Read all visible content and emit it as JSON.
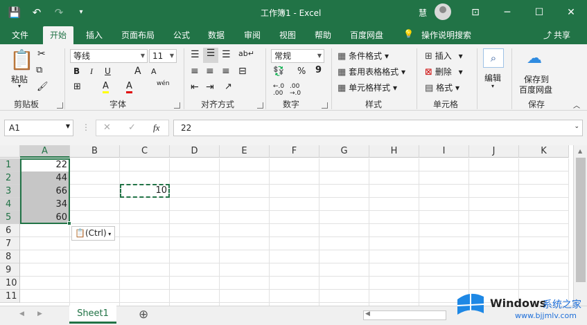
{
  "titlebar": {
    "title": "工作簿1  -  Excel",
    "user": "慧",
    "qat": {
      "save_icon": "💾",
      "undo_icon": "↶",
      "redo_icon": "↷",
      "customize_icon": "▾"
    },
    "window": {
      "ribbon_options": "⊡",
      "minimize": "─",
      "maximize": "☐",
      "close": "✕"
    }
  },
  "tabs": [
    "文件",
    "开始",
    "插入",
    "页面布局",
    "公式",
    "数据",
    "审阅",
    "视图",
    "帮助",
    "百度网盘"
  ],
  "tell_me": "操作说明搜索",
  "share": "共享",
  "ribbon": {
    "clipboard": {
      "label": "剪贴板",
      "paste": "粘贴"
    },
    "font": {
      "label": "字体",
      "name": "等线",
      "size": "11",
      "bold": "B",
      "italic": "I",
      "underline": "U",
      "grow": "A",
      "shrink": "A",
      "fill_icon": "A",
      "color_icon": "A",
      "wen": "wén"
    },
    "alignment": {
      "label": "对齐方式"
    },
    "number": {
      "label": "数字",
      "format": "常规",
      "percent": "%",
      "comma": "9"
    },
    "styles": {
      "label": "样式",
      "conditional": "条件格式",
      "as_table": "套用表格格式",
      "cell_styles": "单元格样式"
    },
    "cells": {
      "label": "单元格",
      "insert": "插入",
      "delete": "删除",
      "format": "格式"
    },
    "editing": {
      "label": "编辑"
    },
    "save": {
      "label": "保存",
      "button_line1": "保存到",
      "button_line2": "百度网盘"
    }
  },
  "formula_bar": {
    "name_box": "A1",
    "value": "22",
    "fx": "fx",
    "cancel": "✕",
    "enter": "✓"
  },
  "columns": [
    "A",
    "B",
    "C",
    "D",
    "E",
    "F",
    "G",
    "H",
    "I",
    "J",
    "K"
  ],
  "rows": [
    "1",
    "2",
    "3",
    "4",
    "5",
    "6",
    "7",
    "8",
    "9",
    "10",
    "11"
  ],
  "cells": {
    "A1": "22",
    "A2": "44",
    "A3": "66",
    "A4": "34",
    "A5": "60",
    "C3": "10"
  },
  "paste_options": "(Ctrl)",
  "sheet_tab": "Sheet1",
  "add_sheet": "⊕",
  "watermark": {
    "brand": "Windows",
    "brand_cn": "系统之家",
    "url": "www.bjjmlv.com"
  }
}
